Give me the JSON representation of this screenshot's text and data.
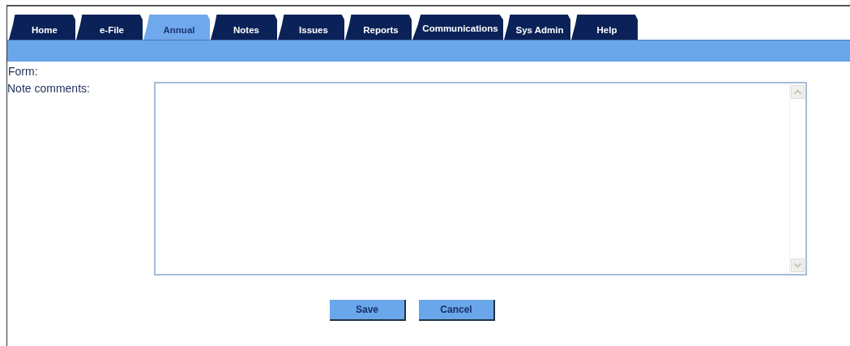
{
  "tabs": [
    {
      "label": "Home",
      "selected": false
    },
    {
      "label": "e-File",
      "selected": false
    },
    {
      "label": "Annual",
      "selected": true
    },
    {
      "label": "Notes",
      "selected": false
    },
    {
      "label": "Issues",
      "selected": false
    },
    {
      "label": "Reports",
      "selected": false
    },
    {
      "label": "Communications",
      "selected": false
    },
    {
      "label": "Sys Admin",
      "selected": false
    },
    {
      "label": "Help",
      "selected": false
    }
  ],
  "form": {
    "form_label": "Form:",
    "note_label": "Note comments:"
  },
  "buttons": [
    "Save",
    "Cancel"
  ]
}
